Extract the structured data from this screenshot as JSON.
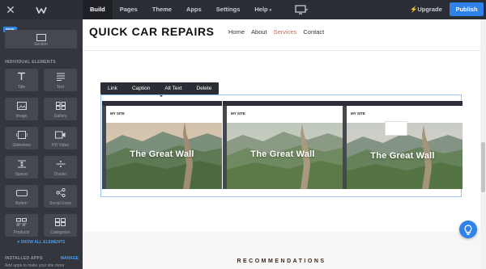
{
  "topbar": {
    "nav": [
      {
        "label": "Build",
        "active": true
      },
      {
        "label": "Pages"
      },
      {
        "label": "Theme"
      },
      {
        "label": "Apps"
      },
      {
        "label": "Settings"
      },
      {
        "label": "Help"
      }
    ],
    "upgrade_label": "Upgrade",
    "publish_label": "Publish"
  },
  "sidebar": {
    "new_badge": "NEW",
    "section_label": "Section",
    "individual_heading": "INDIVIDUAL ELEMENTS",
    "elements": [
      {
        "label": "Title",
        "icon": "title-icon"
      },
      {
        "label": "Text",
        "icon": "text-icon"
      },
      {
        "label": "Image",
        "icon": "image-icon"
      },
      {
        "label": "Gallery",
        "icon": "gallery-icon"
      },
      {
        "label": "Slideshow",
        "icon": "slideshow-icon"
      },
      {
        "label": "HD Video",
        "icon": "video-icon"
      },
      {
        "label": "Spacer",
        "icon": "spacer-icon"
      },
      {
        "label": "Divider",
        "icon": "divider-icon"
      },
      {
        "label": "Button",
        "icon": "button-icon"
      },
      {
        "label": "Social Icons",
        "icon": "share-icon"
      },
      {
        "label": "Products",
        "icon": "products-icon"
      },
      {
        "label": "Categories",
        "icon": "categories-icon"
      }
    ],
    "show_all_label": "SHOW ALL ELEMENTS",
    "installed_heading": "INSTALLED APPS",
    "manage_label": "MANAGE",
    "apps_hint": "Add apps to make your site more"
  },
  "site": {
    "title": "QUICK CAR REPAIRS",
    "nav": [
      {
        "label": "Home"
      },
      {
        "label": "About"
      },
      {
        "label": "Services",
        "active": true
      },
      {
        "label": "Contact"
      }
    ]
  },
  "gallery_toolbar": [
    "Link",
    "Caption",
    "Alt Text",
    "Delete"
  ],
  "gallery": [
    {
      "site_label": "MY SITE",
      "caption": "The Great Wall"
    },
    {
      "site_label": "MY SITE",
      "caption": "The Great Wall"
    },
    {
      "site_label": "MY SITE",
      "caption": "The Great Wall"
    }
  ],
  "recommendations_heading": "RECOMMENDATIONS",
  "colors": {
    "accent": "#2f82e8",
    "active_link": "#e35b4f",
    "toolbar_bg": "#2b2e34"
  }
}
